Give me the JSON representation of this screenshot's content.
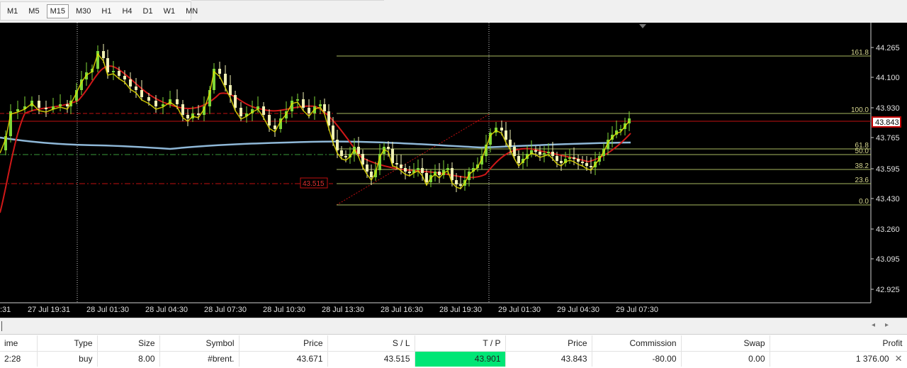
{
  "toolbar": {
    "timeframes": [
      {
        "label": "M1",
        "active": false
      },
      {
        "label": "M5",
        "active": false
      },
      {
        "label": "M15",
        "active": true
      },
      {
        "label": "M30",
        "active": false
      },
      {
        "label": "H1",
        "active": false
      },
      {
        "label": "H4",
        "active": false
      },
      {
        "label": "D1",
        "active": false
      },
      {
        "label": "W1",
        "active": false
      },
      {
        "label": "MN",
        "active": false
      }
    ]
  },
  "chart": {
    "price_axis": [
      "44.265",
      "44.100",
      "43.930",
      "43.765",
      "43.595",
      "43.430",
      "43.260",
      "43.095",
      "42.925"
    ],
    "time_axis": [
      ":31",
      "27 Jul 19:31",
      "28 Jul 01:30",
      "28 Jul 04:30",
      "28 Jul 07:30",
      "28 Jul 10:30",
      "28 Jul 13:30",
      "28 Jul 16:30",
      "28 Jul 19:30",
      "29 Jul 01:30",
      "29 Jul 04:30",
      "29 Jul 07:30"
    ],
    "current_price": "43.843",
    "stop_loss_label": "43.515",
    "fib_levels": [
      "161.8",
      "100.0",
      "61.8",
      "50.0",
      "38.2",
      "23.6",
      "0.0"
    ],
    "colors": {
      "background": "#000000",
      "candle_up": "#7fd638",
      "candle_down": "#f0f0b4",
      "ma_red": "#d01818",
      "ma_yellow": "#e8e000",
      "ma_blue": "#8fb8d8",
      "fib": "#a8b860",
      "current_price_bg": "#c00000"
    }
  },
  "table": {
    "headers": {
      "time": "ime",
      "type": "Type",
      "size": "Size",
      "symbol": "Symbol",
      "price": "Price",
      "sl": "S / L",
      "tp": "T / P",
      "price2": "Price",
      "commission": "Commission",
      "swap": "Swap",
      "profit": "Profit"
    },
    "row": {
      "time": "2:28",
      "type": "buy",
      "size": "8.00",
      "symbol": "#brent.",
      "price": "43.671",
      "sl": "43.515",
      "tp": "43.901",
      "price2": "43.843",
      "commission": "-80.00",
      "swap": "0.00",
      "profit": "1 376.00"
    }
  }
}
